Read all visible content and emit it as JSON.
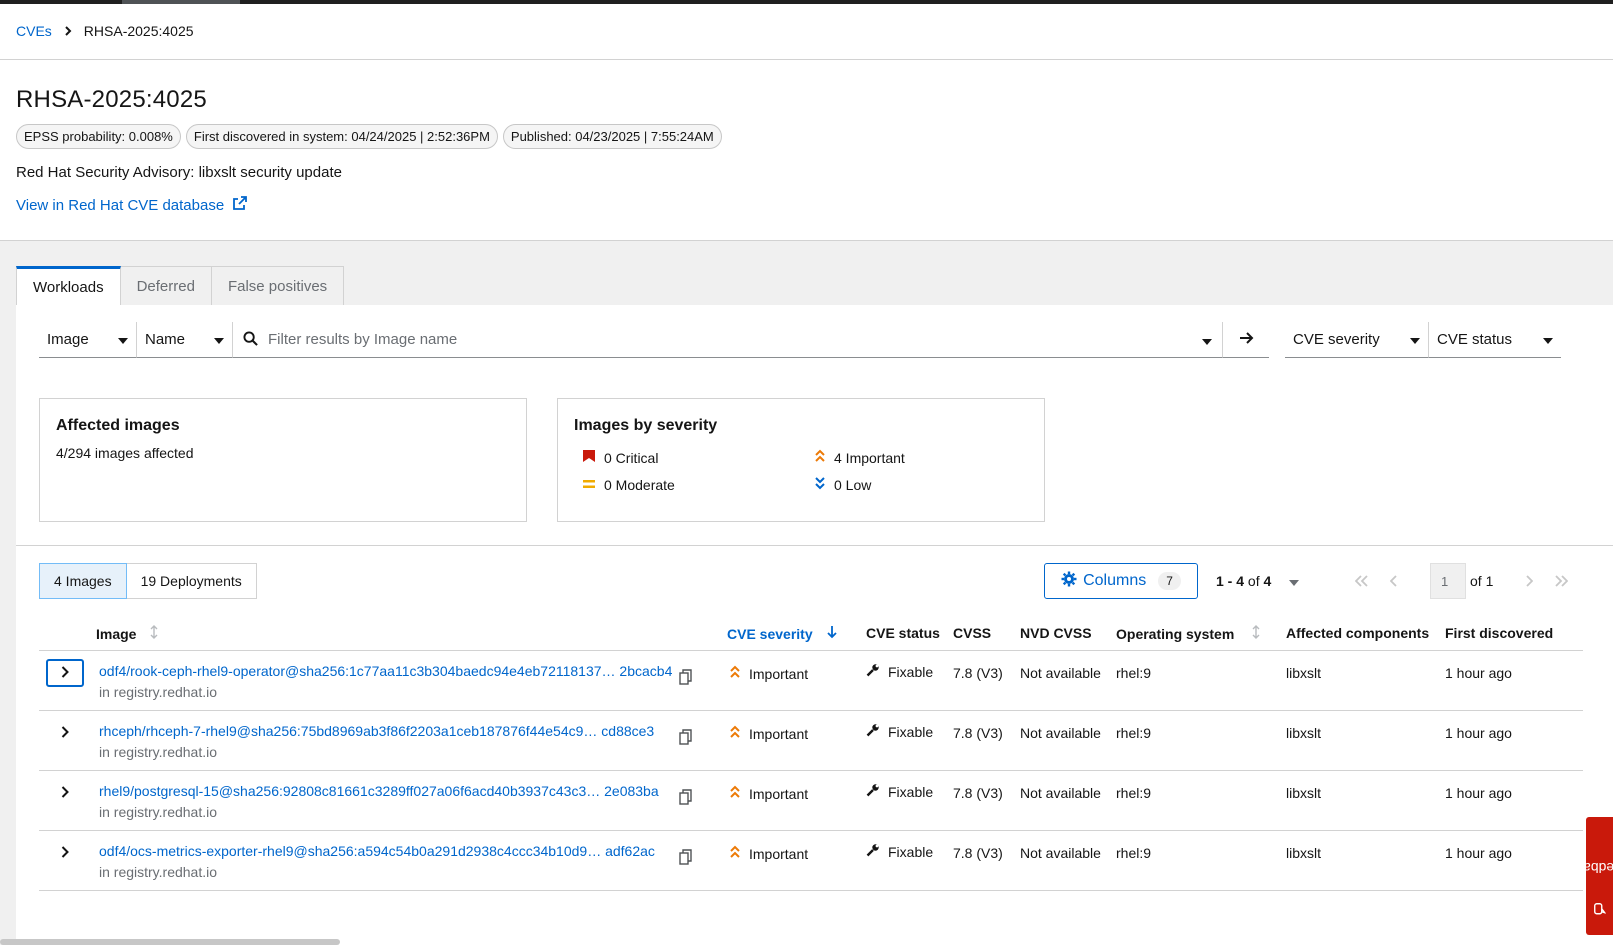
{
  "breadcrumb": {
    "root": "CVEs",
    "current": "RHSA-2025:4025"
  },
  "title": "RHSA-2025:4025",
  "labels": [
    "EPSS probability: 0.008%",
    "First discovered in system: 04/24/2025 | 2:52:36PM",
    "Published: 04/23/2025 | 7:55:24AM"
  ],
  "summary": "Red Hat Security Advisory: libxslt security update",
  "external_link": "View in Red Hat CVE database",
  "tabs": [
    "Workloads",
    "Deferred",
    "False positives"
  ],
  "toolbar": {
    "entity_select": "Image",
    "attribute_select": "Name",
    "search_placeholder": "Filter results by Image name",
    "severity_filter": "CVE severity",
    "status_filter": "CVE status"
  },
  "affected_card": {
    "title": "Affected images",
    "text": "4/294 images affected"
  },
  "severity_card": {
    "title": "Images by severity",
    "critical": "0 Critical",
    "important": "4 Important",
    "moderate": "0 Moderate",
    "low": "0 Low"
  },
  "colors": {
    "critical": "#c9190b",
    "important": "#ec7a08",
    "moderate": "#f0ab00",
    "low": "#0066cc",
    "link": "#0066cc"
  },
  "entity_toggle": {
    "images": "4 Images",
    "deployments": "19 Deployments"
  },
  "columns_button": {
    "label": "Columns",
    "count": "7"
  },
  "pagination": {
    "range": "1 - 4",
    "of_label": "of",
    "total": "4",
    "page": "1",
    "page_of": "of 1"
  },
  "table": {
    "headers": {
      "image": "Image",
      "severity": "CVE severity",
      "status": "CVE status",
      "cvss": "CVSS",
      "nvd": "NVD CVSS",
      "os": "Operating system",
      "components": "Affected components",
      "first": "First discovered"
    },
    "rows": [
      {
        "name": "odf4/rook-ceph-rhel9-operator@sha256:1c77aa11c3b304baedc94e4eb72118137… 2bcacb4",
        "registry": "in registry.redhat.io",
        "severity": "Important",
        "status": "Fixable",
        "cvss": "7.8 (V3)",
        "nvd": "Not available",
        "os": "rhel:9",
        "components": "libxslt",
        "first": "1 hour ago"
      },
      {
        "name": "rhceph/rhceph-7-rhel9@sha256:75bd8969ab3f86f2203a1ceb187876f44e54c9… cd88ce3",
        "registry": "in registry.redhat.io",
        "severity": "Important",
        "status": "Fixable",
        "cvss": "7.8 (V3)",
        "nvd": "Not available",
        "os": "rhel:9",
        "components": "libxslt",
        "first": "1 hour ago"
      },
      {
        "name": "rhel9/postgresql-15@sha256:92808c81661c3289ff027a06f6acd40b3937c43c3… 2e083ba",
        "registry": "in registry.redhat.io",
        "severity": "Important",
        "status": "Fixable",
        "cvss": "7.8 (V3)",
        "nvd": "Not available",
        "os": "rhel:9",
        "components": "libxslt",
        "first": "1 hour ago"
      },
      {
        "name": "odf4/ocs-metrics-exporter-rhel9@sha256:a594c54b0a291d2938c4ccc34b10d9… adf62ac",
        "registry": "in registry.redhat.io",
        "severity": "Important",
        "status": "Fixable",
        "cvss": "7.8 (V3)",
        "nvd": "Not available",
        "os": "rhel:9",
        "components": "libxslt",
        "first": "1 hour ago"
      }
    ]
  },
  "feedback": "Feedback"
}
